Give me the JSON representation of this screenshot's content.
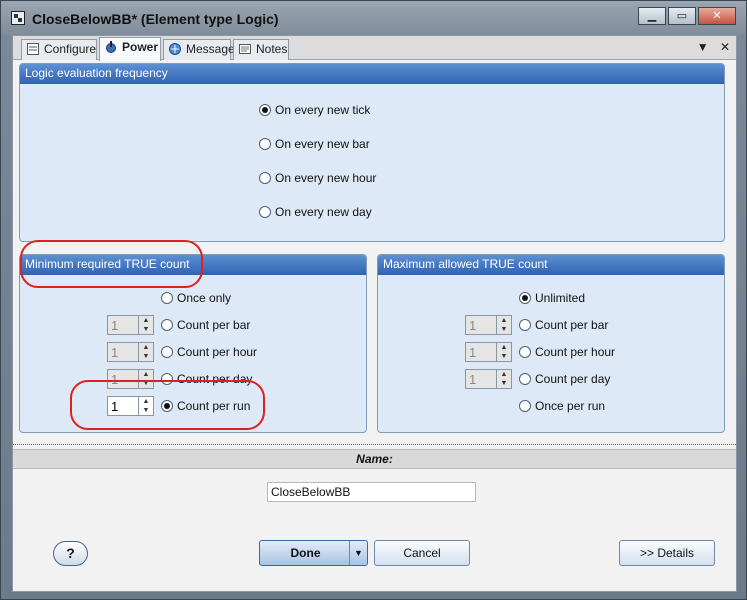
{
  "window": {
    "title": "CloseBelowBB* (Element type Logic)"
  },
  "tabs": [
    {
      "label": "Configure",
      "icon": "configure-icon"
    },
    {
      "label": "Power",
      "icon": "power-icon"
    },
    {
      "label": "Message",
      "icon": "message-icon"
    },
    {
      "label": "Notes",
      "icon": "notes-icon"
    }
  ],
  "tab_tools": {
    "dropdown": "▼",
    "close": "✕"
  },
  "frequency": {
    "header": "Logic evaluation frequency",
    "options": [
      "On every new tick",
      "On every new bar",
      "On every new hour",
      "On every new day"
    ],
    "selected": "On every new tick"
  },
  "min_count": {
    "header": "Minimum required TRUE count",
    "once_label": "Once only",
    "rows": [
      {
        "value": "1",
        "label": "Count per bar"
      },
      {
        "value": "1",
        "label": "Count per hour"
      },
      {
        "value": "1",
        "label": "Count per day"
      },
      {
        "value": "1",
        "label": "Count per run"
      }
    ],
    "selected": "Count per run"
  },
  "max_count": {
    "header": "Maximum allowed TRUE count",
    "unlimited_label": "Unlimited",
    "rows": [
      {
        "value": "1",
        "label": "Count per bar"
      },
      {
        "value": "1",
        "label": "Count per hour"
      },
      {
        "value": "1",
        "label": "Count per day"
      }
    ],
    "once_per_run_label": "Once per run",
    "selected": "Unlimited"
  },
  "name": {
    "label": "Name:",
    "value": "CloseBelowBB"
  },
  "buttons": {
    "help": "?",
    "done": "Done",
    "cancel": "Cancel",
    "details": ">> Details"
  },
  "colors": {
    "panel_header": "#2f63b3",
    "panel_bg": "#dde9f7",
    "annotation": "#e02020"
  }
}
